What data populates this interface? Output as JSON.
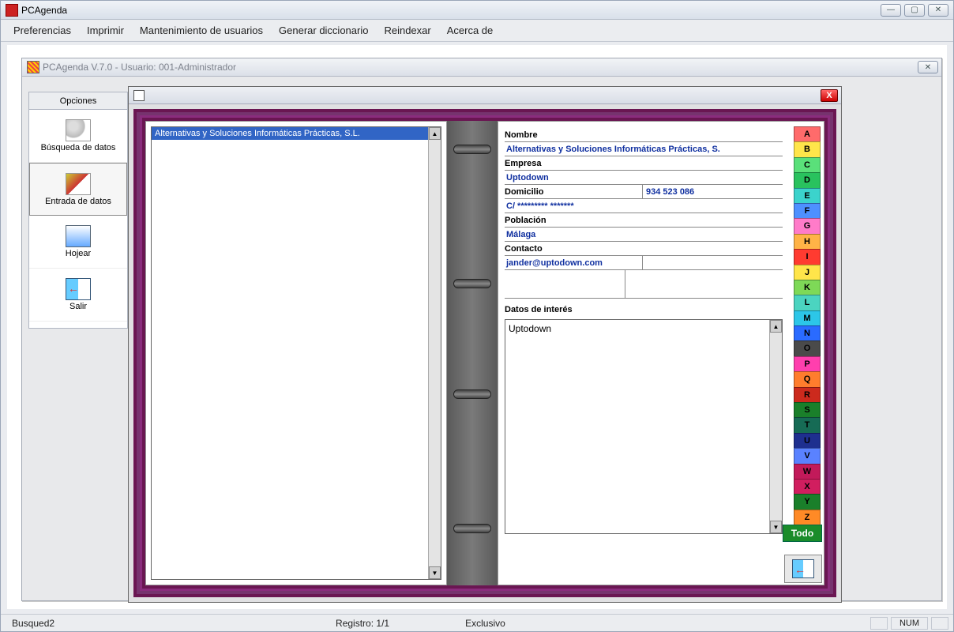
{
  "app": {
    "title": "PCAgenda"
  },
  "menu": {
    "items": [
      "Preferencias",
      "Imprimir",
      "Mantenimiento de usuarios",
      "Generar diccionario",
      "Reindexar",
      "Acerca de"
    ]
  },
  "child": {
    "title": "PCAgenda  V.7.0 - Usuario: 001-Administrador"
  },
  "sidebar": {
    "header": "Opciones",
    "items": [
      {
        "label": "Búsqueda de datos"
      },
      {
        "label": "Entrada de datos"
      },
      {
        "label": "Hojear"
      },
      {
        "label": "Salir"
      }
    ]
  },
  "list": {
    "items": [
      {
        "text": "Alternativas y Soluciones Informáticas Prácticas, S.L.",
        "selected": true
      }
    ]
  },
  "form": {
    "nombre_label": "Nombre",
    "nombre_value": "Alternativas y Soluciones Informáticas Prácticas, S.",
    "empresa_label": "Empresa",
    "empresa_value": "Uptodown",
    "domicilio_label": "Domicilio",
    "domicilio_value": "C/ ********* *******",
    "telefono_value": "934 523 086",
    "poblacion_label": "Población",
    "poblacion_value": "Málaga",
    "contacto_label": "Contacto",
    "contacto_value": "jander@uptodown.com",
    "datos_label": "Datos de interés",
    "datos_value": "Uptodown"
  },
  "az": {
    "letters": [
      "A",
      "B",
      "C",
      "D",
      "E",
      "F",
      "G",
      "H",
      "I",
      "J",
      "K",
      "L",
      "M",
      "N",
      "O",
      "P",
      "Q",
      "R",
      "S",
      "T",
      "U",
      "V",
      "W",
      "X",
      "Y",
      "Z"
    ],
    "colors": [
      "#ff6b6b",
      "#ffe54a",
      "#5ae07a",
      "#29c25e",
      "#3bd3cc",
      "#4e90ff",
      "#ff7bc9",
      "#ffb347",
      "#ff3b30",
      "#ffe54a",
      "#7ed957",
      "#4bd4c0",
      "#2cc6e8",
      "#2a6bff",
      "#4a4a4a",
      "#ff3fae",
      "#ff7d2d",
      "#cc2a1d",
      "#1a7f2a",
      "#166b55",
      "#1e2f8f",
      "#5a82ff",
      "#c21a5a",
      "#d11e5f",
      "#1a7f2a",
      "#ff8a26"
    ],
    "todo": "Todo"
  },
  "status": {
    "left": "Busqued2",
    "record": "Registro: 1/1",
    "mode": "Exclusivo",
    "num": "NUM"
  }
}
